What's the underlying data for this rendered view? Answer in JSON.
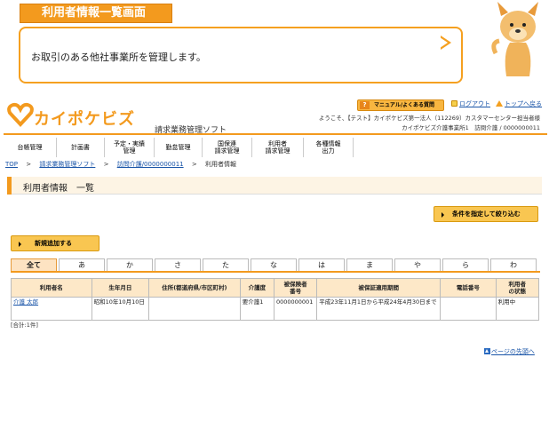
{
  "banner": {
    "title": "利用者情報一覧画面",
    "description": "お取引のある他社事業所を管理します。"
  },
  "header": {
    "logo_text": "カイポケビズ",
    "logo_sub": "請求業務管理ソフト",
    "help_label": "マニュアル/よくある質問",
    "help_icon": "?",
    "logout_label": "ログアウト",
    "top_label": "トップへ戻る",
    "welcome_line1": "ようこそ、【テスト】カイポケビズ第一法人（112269）カスタマーセンター担当者様",
    "welcome_line2": "カイポケビズ介護事業所1　訪問介護 / 0000000011",
    "brand_color": "#f39a1e"
  },
  "nav": {
    "items": [
      {
        "label": "台帳管理"
      },
      {
        "label": "計画書"
      },
      {
        "label": "予定・実績\n管理"
      },
      {
        "label": "勤怠管理"
      },
      {
        "label": "国保連\n請求管理"
      },
      {
        "label": "利用者\n請求管理"
      },
      {
        "label": "各種情報\n出力"
      }
    ]
  },
  "breadcrumb": {
    "items": [
      "TOP",
      "請求業務管理ソフト",
      "訪問介護/0000000011",
      "利用者情報"
    ],
    "separator": ">"
  },
  "page": {
    "heading": "利用者情報　一覧",
    "filter_button": "条件を指定して絞り込む",
    "add_button": "新規追加する"
  },
  "kana_tabs": {
    "items": [
      "全て",
      "あ",
      "か",
      "さ",
      "た",
      "な",
      "は",
      "ま",
      "や",
      "ら",
      "わ"
    ],
    "active": "全て"
  },
  "table": {
    "headers": [
      "利用者名",
      "生年月日",
      "住所(都道府県/市区町村)",
      "介護度",
      "被保険者\n番号",
      "被保証適用期間",
      "電話番号",
      "利用者\nの状態"
    ],
    "rows": [
      [
        "介護 太郎",
        "昭和10年10月10日",
        "",
        "要介護1",
        "0000000001",
        "平成23年11月1日から平成24年4月30日まで",
        "",
        "利用中"
      ]
    ]
  },
  "footer": {
    "total": "[合計:1件]",
    "page_top": "ページの先頭へ"
  }
}
